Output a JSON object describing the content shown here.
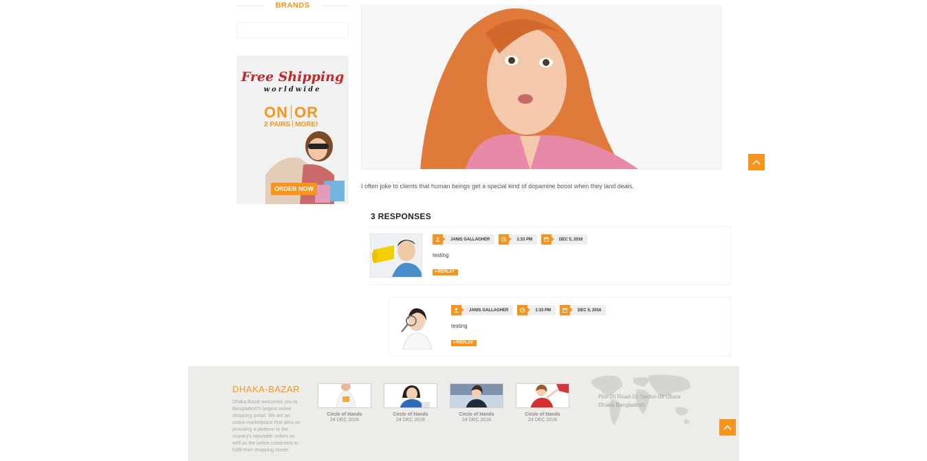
{
  "sidebar": {
    "brands_title": "BRANDS",
    "promo": {
      "title": "Free Shipping",
      "subtitle": "worldwide",
      "deal_line1_left": "ON",
      "deal_line1_right": "OR",
      "deal_line2_left": "2 PAIRS",
      "deal_line2_right": "MORE!",
      "cta": "ORDER NOW"
    }
  },
  "post": {
    "text": "I often joke to clients that human beings get a special kind of dopamine boost when they land deals."
  },
  "responses": {
    "title": "3 RESPONSES",
    "comments": [
      {
        "author": "JANIS GALLAGHER",
        "time": "1:33 PM",
        "date": "DEC 5, 2016",
        "text": "testing",
        "reply_label": "REPLAY"
      },
      {
        "author": "JANIS GALLAGHER",
        "time": "1:33 PM",
        "date": "DEC 5, 2016",
        "text": "testing",
        "reply_label": "REPLAY"
      }
    ]
  },
  "footer": {
    "brand_main": "DHAKA",
    "brand_rest": "-BAZAR",
    "about": "Dhaka Bazar welcomes you to Bangladesh's largest online shopping portal. We are an online marketplace that aims on providing a platform to the country's reputable sellers as well as the online customers to fulfill their shopping needs.",
    "gallery": [
      {
        "title": "Circle of Hands",
        "date": "24 DEC 2016"
      },
      {
        "title": "Circle of Hands",
        "date": "24 DEC 2016"
      },
      {
        "title": "Circle of Hands",
        "date": "24 DEC 2016"
      },
      {
        "title": "Circle of Hands",
        "date": "24 DEC 2016"
      }
    ],
    "address": "Plot-20 Road-01-Sector-09 Uttara Dhaka Bangladesh"
  },
  "colors": {
    "accent": "#f7941d",
    "footer_bg": "#edece8"
  },
  "icons": [
    "user-icon",
    "clock-icon",
    "calendar-icon",
    "reply-arrow-icon",
    "chevron-up-icon",
    "world-map-icon"
  ]
}
